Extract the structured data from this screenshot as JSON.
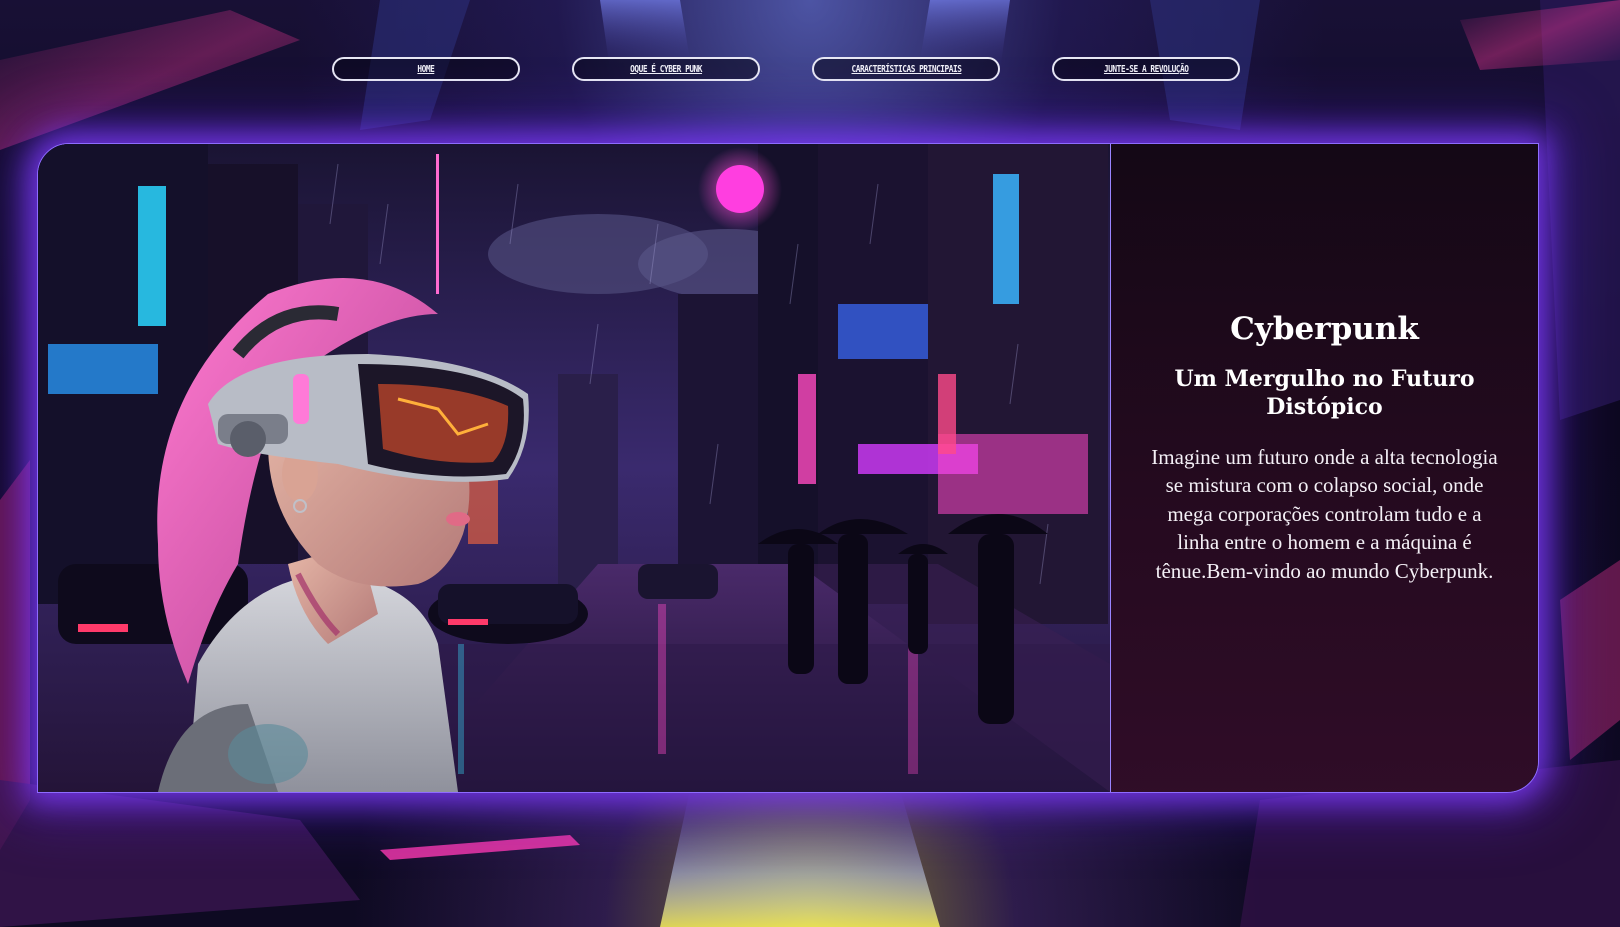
{
  "nav": {
    "items": [
      {
        "label": "HOME"
      },
      {
        "label": "Oque é Cyber Punk"
      },
      {
        "label": "Características Principais"
      },
      {
        "label": "Junte-se a Revolução"
      }
    ]
  },
  "hero": {
    "title": "Cyberpunk",
    "subtitle": "Um Mergulho no Futuro Distópico",
    "text": "Imagine um futuro onde a alta tecnologia se mistura com o colapso social, onde mega corporações controlam tudo e a linha entre o homem e a máquina é tênue.Bem-vindo ao mundo Cyberpunk."
  },
  "colors": {
    "accent_glow": "#8e6cff",
    "neon_pink": "#ff3ec8",
    "neon_cyan": "#3ee0ff",
    "panel_text": "#ffffff"
  },
  "icons": {
    "hero_image": "cyberpunk-city-vr-girl-illustration",
    "background": "neon-corridor-background"
  }
}
